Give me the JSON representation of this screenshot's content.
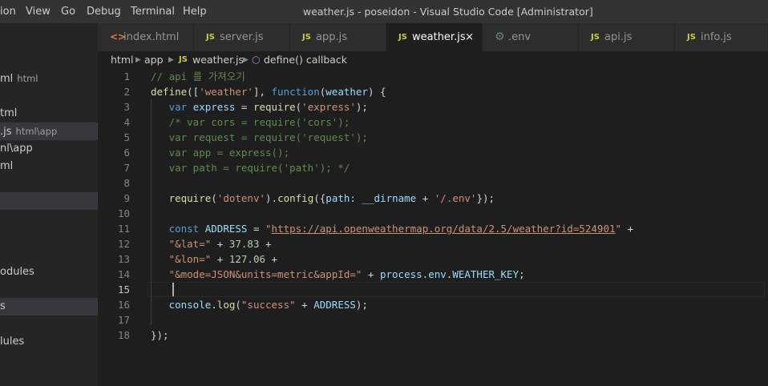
{
  "menu": [
    "ion",
    "View",
    "Go",
    "Debug",
    "Terminal",
    "Help"
  ],
  "window_title": "weather.js - poseidon - Visual Studio Code [Administrator]",
  "sidebar": {
    "items": [
      {
        "label": "ml",
        "sub": "html"
      },
      {
        "label": "tml",
        "sub": ""
      },
      {
        "label": ".js",
        "sub": "html\\app"
      },
      {
        "label": "nl\\app",
        "sub": ""
      },
      {
        "label": "ml",
        "sub": ""
      },
      {
        "label": "odules",
        "sub": ""
      },
      {
        "label": "s",
        "sub": ""
      },
      {
        "label": "lules",
        "sub": ""
      }
    ]
  },
  "tabs": [
    {
      "icon": "html-icon",
      "label": "index.html"
    },
    {
      "icon": "js-icon",
      "label": "server.js"
    },
    {
      "icon": "js-icon",
      "label": "app.js"
    },
    {
      "icon": "js-icon",
      "label": "weather.js",
      "active": true
    },
    {
      "icon": "gear-icon",
      "label": ".env"
    },
    {
      "icon": "js-icon",
      "label": "api.js"
    },
    {
      "icon": "js-icon",
      "label": "info.js"
    }
  ],
  "icons": {
    "js": "JS",
    "html": "<>",
    "gear": "⚙",
    "close": "×",
    "chevron": "▶",
    "cube": "⬡"
  },
  "breadcrumb": {
    "part1": "html",
    "part2": "app",
    "part3": "weather.js",
    "part4": "define() callback"
  },
  "editor": {
    "current_line": 15,
    "line_numbers": [
      "1",
      "2",
      "3",
      "4",
      "5",
      "6",
      "7",
      "8",
      "9",
      "10",
      "11",
      "12",
      "13",
      "14",
      "15",
      "16",
      "17",
      "18"
    ],
    "lines": [
      [
        {
          "t": "// api 를 가져오기",
          "c": "com"
        }
      ],
      [
        {
          "t": "define",
          "c": "fn"
        },
        {
          "t": "([",
          "c": "pl"
        },
        {
          "t": "'weather'",
          "c": "str"
        },
        {
          "t": "], ",
          "c": "pl"
        },
        {
          "t": "function",
          "c": "kw"
        },
        {
          "t": "(",
          "c": "pl"
        },
        {
          "t": "weather",
          "c": "var"
        },
        {
          "t": ") {",
          "c": "pl"
        }
      ],
      [
        {
          "t": "   ",
          "c": "pl"
        },
        {
          "t": "var",
          "c": "kw"
        },
        {
          "t": " ",
          "c": "pl"
        },
        {
          "t": "express",
          "c": "var"
        },
        {
          "t": " = ",
          "c": "pl"
        },
        {
          "t": "require",
          "c": "fn"
        },
        {
          "t": "(",
          "c": "pl"
        },
        {
          "t": "'express'",
          "c": "str"
        },
        {
          "t": ");",
          "c": "pl"
        }
      ],
      [
        {
          "t": "   ",
          "c": "pl"
        },
        {
          "t": "/* var cors = require('cors');",
          "c": "com"
        }
      ],
      [
        {
          "t": "   var request = require('request');",
          "c": "com"
        }
      ],
      [
        {
          "t": "   var app = express();",
          "c": "com"
        }
      ],
      [
        {
          "t": "   var path = require('path'); */",
          "c": "com"
        }
      ],
      [],
      [
        {
          "t": "   ",
          "c": "pl"
        },
        {
          "t": "require",
          "c": "fn"
        },
        {
          "t": "(",
          "c": "pl"
        },
        {
          "t": "'dotenv'",
          "c": "str"
        },
        {
          "t": ").",
          "c": "pl"
        },
        {
          "t": "config",
          "c": "fn"
        },
        {
          "t": "({",
          "c": "pl"
        },
        {
          "t": "path",
          "c": "var"
        },
        {
          "t": ": ",
          "c": "pl"
        },
        {
          "t": "__dirname",
          "c": "var"
        },
        {
          "t": " + ",
          "c": "pl"
        },
        {
          "t": "'/.env'",
          "c": "str"
        },
        {
          "t": "});",
          "c": "pl"
        }
      ],
      [],
      [
        {
          "t": "   ",
          "c": "pl"
        },
        {
          "t": "const",
          "c": "kw"
        },
        {
          "t": " ",
          "c": "pl"
        },
        {
          "t": "ADDRESS",
          "c": "var"
        },
        {
          "t": " = ",
          "c": "pl"
        },
        {
          "t": "\"",
          "c": "str"
        },
        {
          "t": "https://api.openweathermap.org/data/2.5/weather?id=524901",
          "c": "url"
        },
        {
          "t": "\"",
          "c": "str"
        },
        {
          "t": " +",
          "c": "pl"
        }
      ],
      [
        {
          "t": "   ",
          "c": "pl"
        },
        {
          "t": "\"&lat=\"",
          "c": "str"
        },
        {
          "t": " + ",
          "c": "pl"
        },
        {
          "t": "37.83",
          "c": "num"
        },
        {
          "t": " +",
          "c": "pl"
        }
      ],
      [
        {
          "t": "   ",
          "c": "pl"
        },
        {
          "t": "\"&lon=\"",
          "c": "str"
        },
        {
          "t": " + ",
          "c": "pl"
        },
        {
          "t": "127.06",
          "c": "num"
        },
        {
          "t": " +",
          "c": "pl"
        }
      ],
      [
        {
          "t": "   ",
          "c": "pl"
        },
        {
          "t": "\"&mode=JSON&units=metric&appId=\"",
          "c": "str"
        },
        {
          "t": " + ",
          "c": "pl"
        },
        {
          "t": "process",
          "c": "var"
        },
        {
          "t": ".",
          "c": "pl"
        },
        {
          "t": "env",
          "c": "var"
        },
        {
          "t": ".",
          "c": "pl"
        },
        {
          "t": "WEATHER_KEY",
          "c": "var"
        },
        {
          "t": ";",
          "c": "pl"
        }
      ],
      [
        {
          "t": "   ",
          "c": "pl"
        }
      ],
      [
        {
          "t": "   ",
          "c": "pl"
        },
        {
          "t": "console",
          "c": "var"
        },
        {
          "t": ".",
          "c": "pl"
        },
        {
          "t": "log",
          "c": "fn"
        },
        {
          "t": "(",
          "c": "pl"
        },
        {
          "t": "\"success\"",
          "c": "str"
        },
        {
          "t": " + ",
          "c": "pl"
        },
        {
          "t": "ADDRESS",
          "c": "var"
        },
        {
          "t": ");",
          "c": "pl"
        }
      ],
      [],
      [
        {
          "t": "});",
          "c": "pl"
        }
      ]
    ]
  },
  "colors": {
    "background": "#1e1e1e",
    "sidebar": "#252526",
    "titlebar": "#333333",
    "comment": "#608b4e",
    "string": "#ce9178",
    "keyword": "#569cd6"
  }
}
